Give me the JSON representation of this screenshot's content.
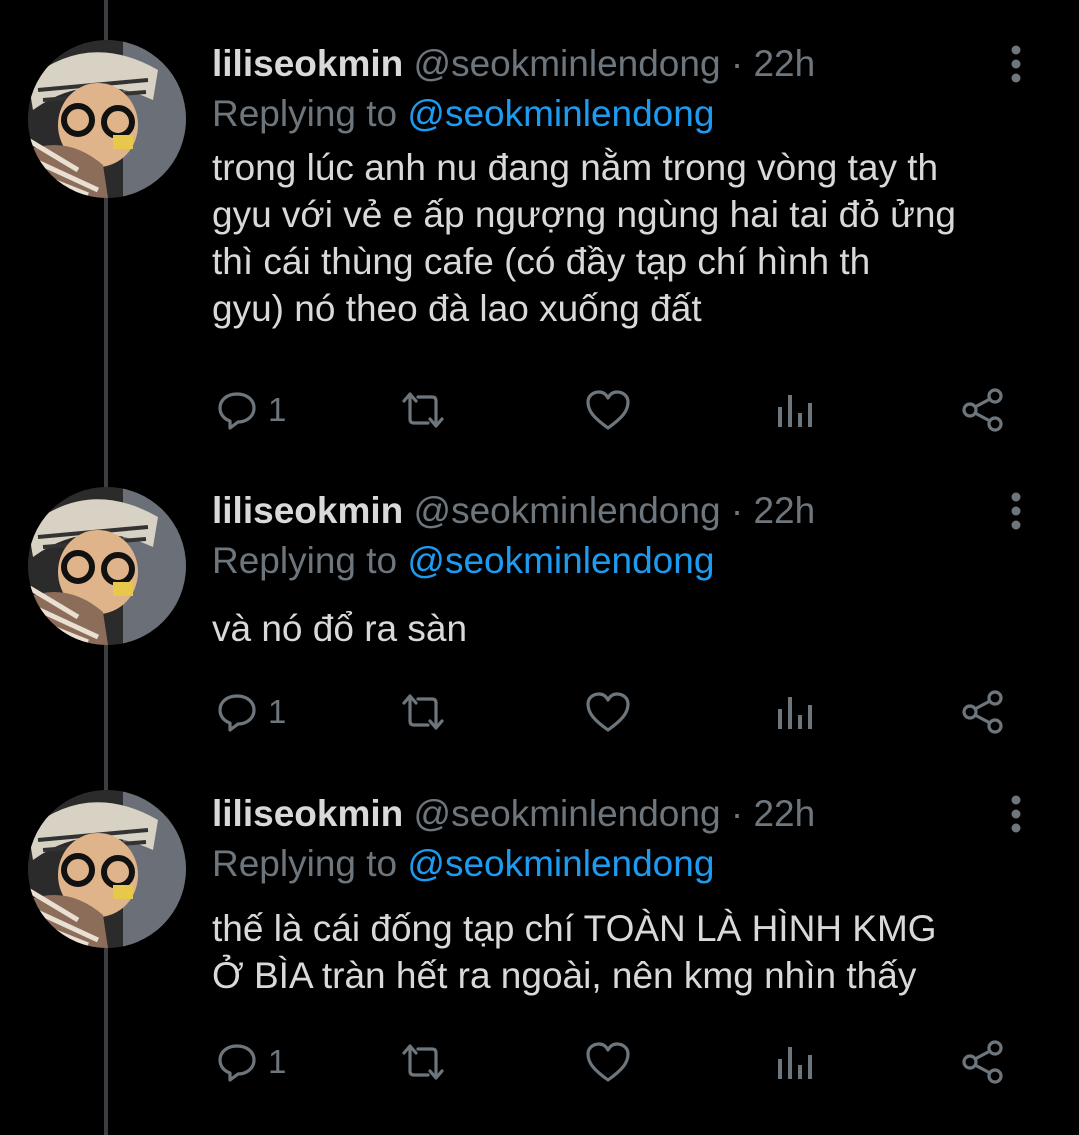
{
  "tweets": [
    {
      "name": "liliseokmin",
      "handle": "@seokminlendong",
      "separator": "·",
      "time": "22h",
      "replying_prefix": "Replying to",
      "replying_to": "@seokminlendong",
      "text": "trong lúc anh nu đang nằm trong vòng tay th\ngyu với vẻ e ấp ngượng ngùng hai tai đỏ ửng\nthì cái thùng cafe (có đầy tạp chí hình th\ngyu) nó theo đà lao xuống đất",
      "reply_count": "1",
      "icons": [
        "reply-icon",
        "retweet-icon",
        "like-icon",
        "analytics-icon",
        "share-icon",
        "more-icon"
      ]
    },
    {
      "name": "liliseokmin",
      "handle": "@seokminlendong",
      "separator": "·",
      "time": "22h",
      "replying_prefix": "Replying to",
      "replying_to": "@seokminlendong",
      "text": "và nó đổ ra sàn",
      "reply_count": "1",
      "icons": [
        "reply-icon",
        "retweet-icon",
        "like-icon",
        "analytics-icon",
        "share-icon",
        "more-icon"
      ]
    },
    {
      "name": "liliseokmin",
      "handle": "@seokminlendong",
      "separator": "·",
      "time": "22h",
      "replying_prefix": "Replying to",
      "replying_to": "@seokminlendong",
      "text": "thế là cái đống tạp chí TOÀN LÀ HÌNH KMG\nỞ BÌA tràn hết ra ngoài, nên kmg nhìn thấy",
      "reply_count": "1",
      "icons": [
        "reply-icon",
        "retweet-icon",
        "like-icon",
        "analytics-icon",
        "share-icon",
        "more-icon"
      ]
    }
  ],
  "colors": {
    "background": "#000000",
    "text": "#d9d9d9",
    "muted": "#6e767d",
    "link": "#1d9bf0",
    "thread_line": "#3a3d41"
  }
}
